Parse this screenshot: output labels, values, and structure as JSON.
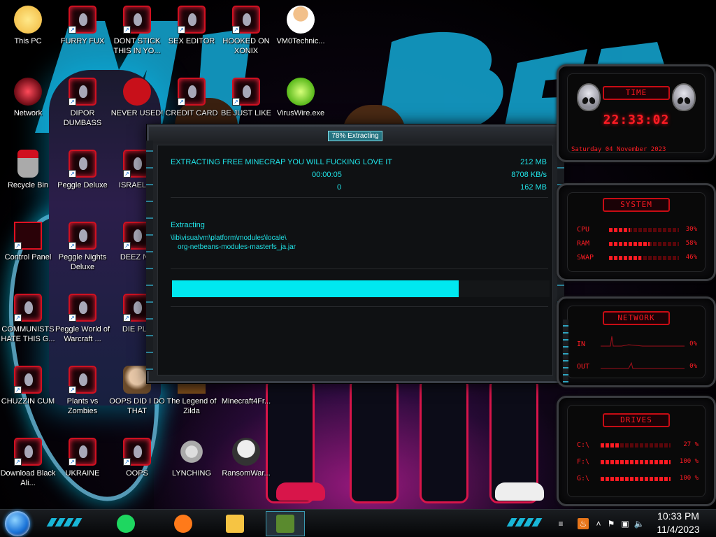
{
  "desktop_icons": [
    {
      "label": "This PC",
      "kind": "pc"
    },
    {
      "label": "FURRY FUX",
      "kind": "alien"
    },
    {
      "label": "DONT STICK THIS IN YO...",
      "kind": "alien"
    },
    {
      "label": "SEX EDITOR",
      "kind": "alien"
    },
    {
      "label": "HOOKED ON XONIX",
      "kind": "alien"
    },
    {
      "label": "VM0Technic...",
      "kind": "person"
    },
    {
      "label": "Network",
      "kind": "network"
    },
    {
      "label": "DIPOR DUMBASS",
      "kind": "alien"
    },
    {
      "label": "NEVER USED!",
      "kind": "dev"
    },
    {
      "label": "CREDIT CARD",
      "kind": "alien"
    },
    {
      "label": "BE JUST LIKE",
      "kind": "alien"
    },
    {
      "label": "VirusWire.exe",
      "kind": "lime"
    },
    {
      "label": "Recycle Bin",
      "kind": "bin"
    },
    {
      "label": "Peggle Deluxe",
      "kind": "alien"
    },
    {
      "label": "ISRAEL SI",
      "kind": "alien"
    },
    {
      "label": "Control Panel",
      "kind": "control"
    },
    {
      "label": "Peggle Nights Deluxe",
      "kind": "alien"
    },
    {
      "label": "DEEZ NU",
      "kind": "alien"
    },
    {
      "label": "COMMUNISTS HATE THIS G...",
      "kind": "alien"
    },
    {
      "label": "Peggle World of Warcraft ...",
      "kind": "alien"
    },
    {
      "label": "DIE PLE",
      "kind": "alien"
    },
    {
      "label": "CHUZZIN CUM",
      "kind": "alien"
    },
    {
      "label": "Plants vs Zombies",
      "kind": "alien"
    },
    {
      "label": "OOPS DID I DO THAT",
      "kind": "portrait"
    },
    {
      "label": "The Legend of Zilda",
      "kind": "game"
    },
    {
      "label": "Minecraft4Fr...",
      "kind": "none"
    },
    {
      "label": "Download Black Ali...",
      "kind": "alien"
    },
    {
      "label": "UKRAINE",
      "kind": "alien"
    },
    {
      "label": "OOPS",
      "kind": "alien"
    },
    {
      "label": "LYNCHING",
      "kind": "lynch"
    },
    {
      "label": "RansomWar...",
      "kind": "skull"
    }
  ],
  "dialog": {
    "title": "78% Extracting",
    "heading": "EXTRACTING FREE MINECRAP YOU WILL FUCKING LOVE IT",
    "elapsed": "00:00:05",
    "remaining": "0",
    "size": "212 MB",
    "speed": "8708 KB/s",
    "processed": "162 MB",
    "status": "Extracting",
    "path_line1": "\\lib\\visualvm\\platform\\modules\\locale\\",
    "path_line2": "org-netbeans-modules-masterfs_ja.jar",
    "progress": 0.76
  },
  "widgets": {
    "time": {
      "header": "Time",
      "clock": "22:33:02",
      "date": "Saturday 04 November 2023"
    },
    "system": {
      "header": "System",
      "rows": [
        {
          "label": "CPU",
          "value": "30%",
          "level": 0.3
        },
        {
          "label": "RAM",
          "value": "58%",
          "level": 0.58
        },
        {
          "label": "SWAP",
          "value": "46%",
          "level": 0.46
        }
      ]
    },
    "network": {
      "header": "Network",
      "rows": [
        {
          "label": "IN",
          "value": "0%"
        },
        {
          "label": "OUT",
          "value": "0%"
        }
      ]
    },
    "drives": {
      "header": "Drives",
      "rows": [
        {
          "label": "C:\\",
          "value": "27 %",
          "level": 0.27
        },
        {
          "label": "F:\\",
          "value": "100 %",
          "level": 1.0
        },
        {
          "label": "G:\\",
          "value": "100 %",
          "level": 1.0
        }
      ]
    }
  },
  "taskbar": {
    "apps": [
      {
        "name": "spotify",
        "color": "#1ed760"
      },
      {
        "name": "firefox",
        "color": "#ff7a1a"
      },
      {
        "name": "file-explorer",
        "color": "#f6c443"
      },
      {
        "name": "minecraft",
        "color": "#5a8a2e"
      }
    ],
    "clock_time": "10:33 PM",
    "clock_date": "11/4/2023"
  },
  "colors": {
    "accent": "#00e8f0",
    "widget_red": "#ff1c24"
  }
}
